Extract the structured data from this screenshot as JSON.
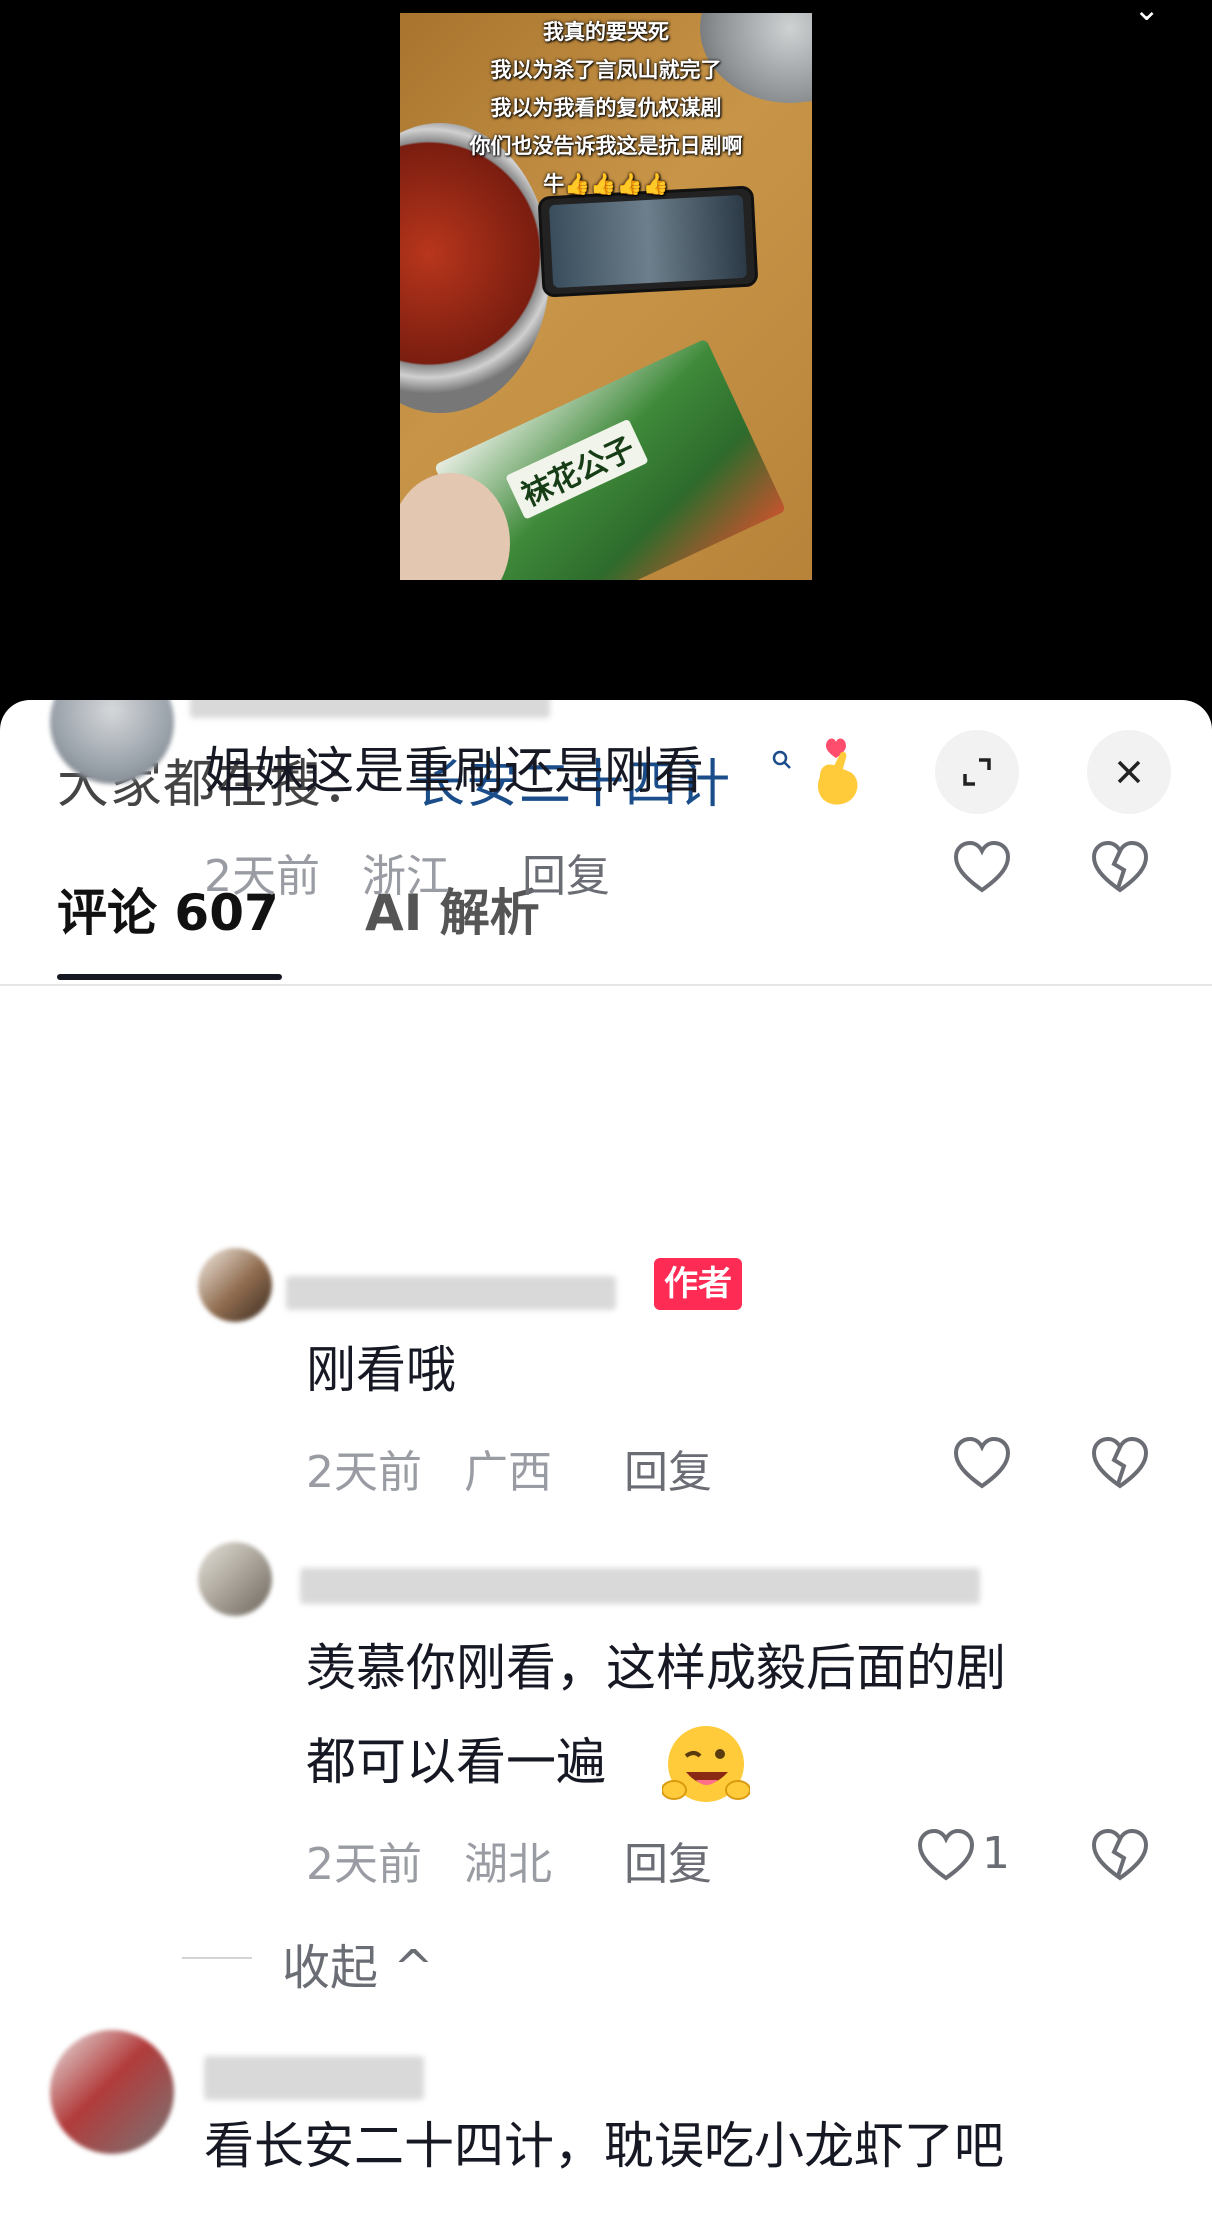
{
  "video": {
    "caption_lines": [
      "我真的要哭死",
      "我以为杀了言凤山就完了",
      "我以为我看的复仇权谋剧",
      "你们也没告诉我这是抗日剧啊",
      "牛👍👍👍👍"
    ],
    "package_text": "袜花公子"
  },
  "search_bar": {
    "prefix": "大家都在搜：",
    "term": "长安二十四计"
  },
  "tabs": {
    "comments_label": "评论 607",
    "ai_label": "AI 解析"
  },
  "comments": [
    {
      "text": "姐妹这是重刷还是刚看",
      "time": "2天前",
      "location": "浙江",
      "reply_label": "回复"
    },
    {
      "badge": "作者",
      "text": "刚看哦",
      "time": "2天前",
      "location": "广西",
      "reply_label": "回复"
    },
    {
      "text_line1": "羡慕你刚看，这样成毅后面的剧",
      "text_line2": "都可以看一遍",
      "time": "2天前",
      "location": "湖北",
      "reply_label": "回复",
      "likes": "1"
    },
    {
      "text": "看长安二十四计，耽误吃小龙虾了吧"
    }
  ],
  "collapse_label": "收起 ^",
  "colors": {
    "search_term": "#1a4d8a",
    "author_badge": "#fe2c55",
    "meta_gray": "#9a9ca3"
  }
}
